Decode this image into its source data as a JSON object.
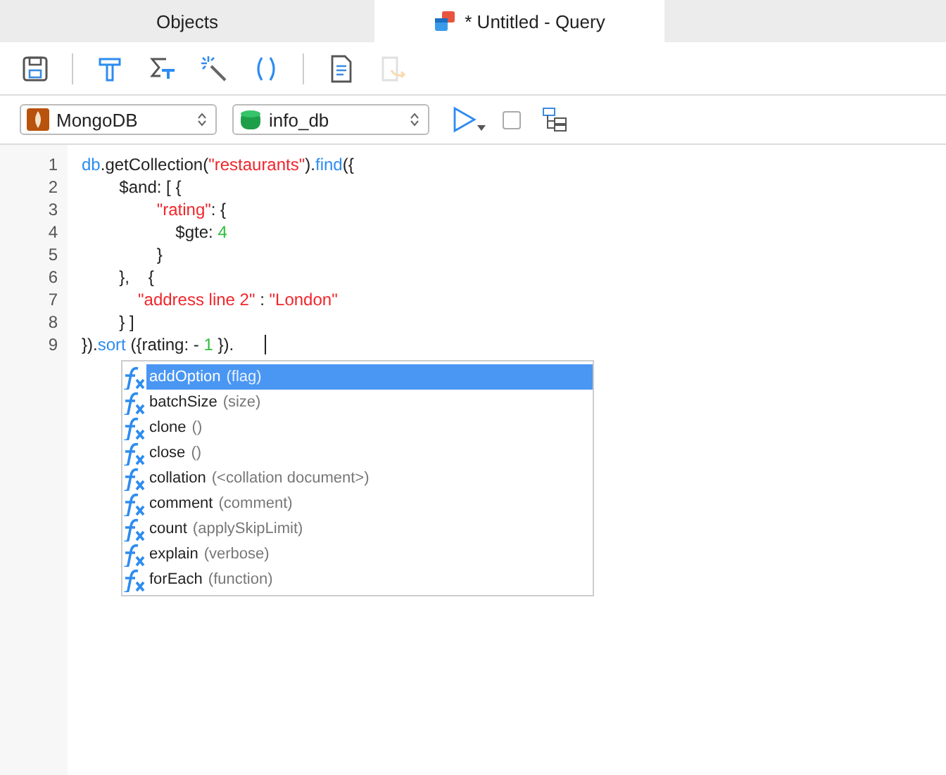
{
  "tabs": [
    {
      "label": "Objects",
      "kind": "objects",
      "selected": false
    },
    {
      "label": "* Untitled - Query",
      "kind": "query",
      "selected": true
    }
  ],
  "toolbar": [
    {
      "kind": "save",
      "disabled": false
    },
    {
      "kind": "sep"
    },
    {
      "kind": "format",
      "disabled": false
    },
    {
      "kind": "sum",
      "disabled": false
    },
    {
      "kind": "magic",
      "disabled": false
    },
    {
      "kind": "parens",
      "disabled": false
    },
    {
      "kind": "sep"
    },
    {
      "kind": "doc",
      "disabled": false
    },
    {
      "kind": "export",
      "disabled": true
    }
  ],
  "connection": {
    "value": "MongoDB"
  },
  "database": {
    "value": "info_db"
  },
  "stop_toggle": {
    "checked": false
  },
  "editor": {
    "lines": [
      {
        "number": "1",
        "tokens": [
          {
            "kind": "method",
            "text": "db"
          },
          {
            "kind": "plain",
            "text": ".getCollection("
          },
          {
            "kind": "string",
            "text": "\"restaurants\""
          },
          {
            "kind": "plain",
            "text": ")."
          },
          {
            "kind": "method",
            "text": "find"
          },
          {
            "kind": "plain",
            "text": "({"
          }
        ]
      },
      {
        "number": "2",
        "tokens": [
          {
            "kind": "plain",
            "text": "        $and: [ {"
          }
        ]
      },
      {
        "number": "3",
        "tokens": [
          {
            "kind": "string",
            "text": "                \"rating\""
          },
          {
            "kind": "plain",
            "text": ": {"
          }
        ]
      },
      {
        "number": "4",
        "tokens": [
          {
            "kind": "plain",
            "text": "                    $gte: "
          },
          {
            "kind": "number",
            "text": "4"
          }
        ]
      },
      {
        "number": "5",
        "tokens": [
          {
            "kind": "plain",
            "text": "                }"
          }
        ]
      },
      {
        "number": "6",
        "tokens": [
          {
            "kind": "plain",
            "text": "        },    {"
          }
        ]
      },
      {
        "number": "7",
        "tokens": [
          {
            "kind": "string",
            "text": "            \"address line 2\""
          },
          {
            "kind": "plain",
            "text": " : "
          },
          {
            "kind": "string",
            "text": "\"London\""
          }
        ]
      },
      {
        "number": "8",
        "tokens": [
          {
            "kind": "plain",
            "text": "        } ]"
          }
        ]
      },
      {
        "number": "9",
        "tokens": [
          {
            "kind": "plain",
            "text": "})."
          },
          {
            "kind": "method",
            "text": "sort"
          },
          {
            "kind": "plain",
            "text": " ({rating: - "
          },
          {
            "kind": "number",
            "text": "1"
          },
          {
            "kind": "plain",
            "text": " })."
          }
        ],
        "cursor": true
      }
    ]
  },
  "completion": {
    "items": [
      {
        "name": "addOption",
        "hint": "(flag)",
        "selected": true
      },
      {
        "name": "batchSize",
        "hint": "(size)",
        "selected": false
      },
      {
        "name": "clone",
        "hint": "()",
        "selected": false
      },
      {
        "name": "close",
        "hint": "()",
        "selected": false
      },
      {
        "name": "collation",
        "hint": "(<collation document>)",
        "selected": false
      },
      {
        "name": "comment",
        "hint": "(comment)",
        "selected": false
      },
      {
        "name": "count",
        "hint": "(applySkipLimit)",
        "selected": false
      },
      {
        "name": "explain",
        "hint": "(verbose)",
        "selected": false
      },
      {
        "name": "forEach",
        "hint": "(function)",
        "selected": false
      }
    ]
  }
}
